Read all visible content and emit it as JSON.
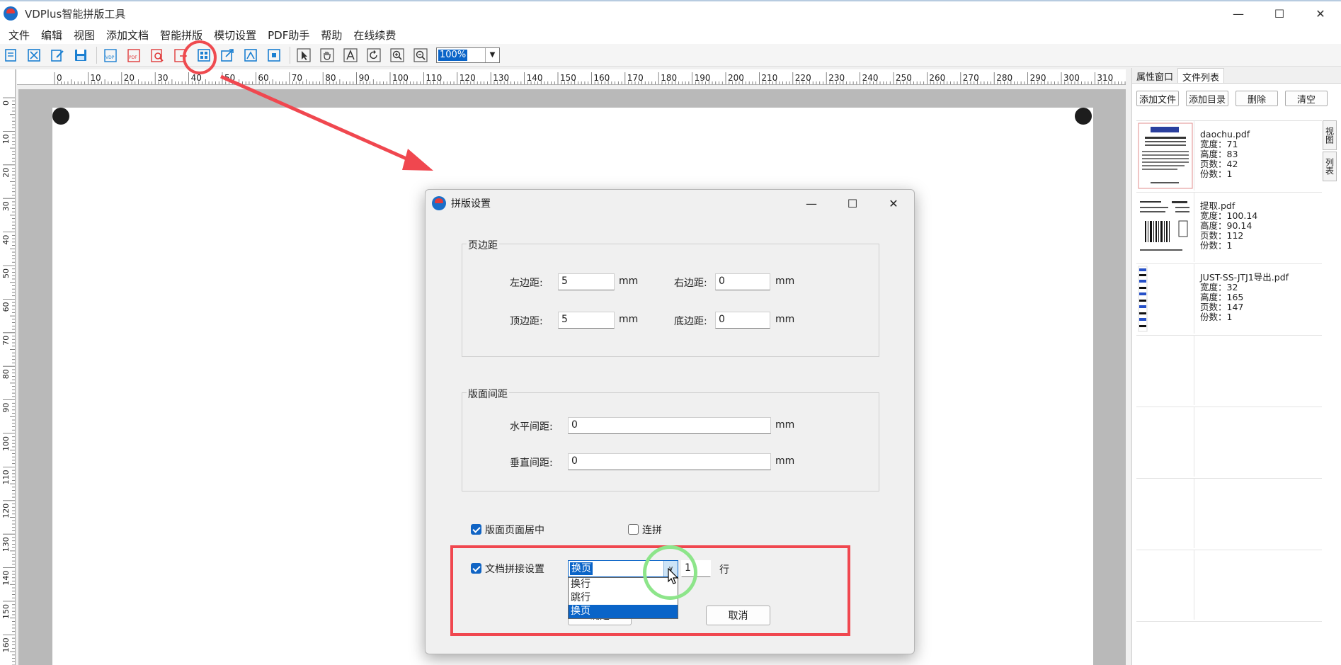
{
  "app": {
    "title": "VDPlus智能拼版工具",
    "window_controls": [
      "minimize-icon",
      "maximize-icon",
      "close-icon"
    ]
  },
  "menu": [
    "文件",
    "编辑",
    "视图",
    "添加文档",
    "智能拼版",
    "模切设置",
    "PDF助手",
    "帮助",
    "在线续费"
  ],
  "toolbar": {
    "zoom_value": "100%",
    "group1": [
      "new-doc-icon",
      "cut-icon",
      "edit-icon",
      "save-icon"
    ],
    "group2": [
      "vdp-icon",
      "pdf-icon",
      "pdf-search-icon",
      "pdf-export-icon",
      "imposition-settings-icon",
      "export-icon",
      "path-icon",
      "fit-icon"
    ],
    "group3": [
      "select-arrow-icon",
      "hand-icon",
      "text-icon",
      "rotate-icon",
      "zoom-in-icon",
      "zoom-out-icon"
    ]
  },
  "ruler_h": [
    "0",
    "10",
    "20",
    "30",
    "40",
    "50",
    "60",
    "70",
    "80",
    "90",
    "100",
    "110",
    "120",
    "130",
    "140",
    "150",
    "160",
    "170",
    "180",
    "190",
    "200",
    "210",
    "220",
    "230",
    "240",
    "250",
    "260",
    "270",
    "280",
    "290",
    "300",
    "310",
    "3"
  ],
  "ruler_v": [
    "0",
    "10",
    "20",
    "30",
    "40",
    "50",
    "60",
    "70",
    "80",
    "90",
    "100",
    "110",
    "120",
    "130",
    "140",
    "150",
    "160"
  ],
  "side_panel": {
    "tabs": [
      "属性窗口",
      "文件列表"
    ],
    "buttons": [
      "添加文件",
      "添加目录",
      "删除",
      "清空"
    ],
    "vertical_tabs": [
      "视图",
      "列表"
    ],
    "files": [
      {
        "name": "daochu.pdf",
        "width": "宽度：71",
        "height": "高度：83",
        "pages": "页数：42",
        "copies": "份数：1"
      },
      {
        "name": "提取.pdf",
        "width": "宽度：100.14",
        "height": "高度：90.14",
        "pages": "页数：112",
        "copies": "份数：1"
      },
      {
        "name": "JUST-SS-JTJ1导出.pdf",
        "width": "宽度：32",
        "height": "高度：165",
        "pages": "页数：147",
        "copies": "份数：1"
      }
    ]
  },
  "dialog": {
    "title": "拼版设置",
    "margin_group": {
      "title": "页边距",
      "left_label": "左边距:",
      "left_value": "5",
      "right_label": "右边距:",
      "right_value": "0",
      "top_label": "顶边距:",
      "top_value": "5",
      "bottom_label": "底边距:",
      "bottom_value": "0",
      "unit": "mm"
    },
    "spacing_group": {
      "title": "版面间距",
      "h_label": "水平间距:",
      "h_value": "0",
      "v_label": "垂直间距:",
      "v_value": "0",
      "unit": "mm"
    },
    "center_label": "版面页面居中",
    "center_checked": true,
    "continuous_label": "连拼",
    "continuous_checked": false,
    "join_label": "文档拼接设置",
    "join_checked": true,
    "join_mode_value": "换页",
    "join_mode_options": [
      "换行",
      "跳行",
      "换页"
    ],
    "join_count": "1",
    "join_unit": "行",
    "ok_label": "确定",
    "cancel_label": "取消"
  },
  "colors": {
    "accent": "#0a64c8",
    "annotation_red": "#f0474f",
    "annotation_green": "#8de58a"
  }
}
